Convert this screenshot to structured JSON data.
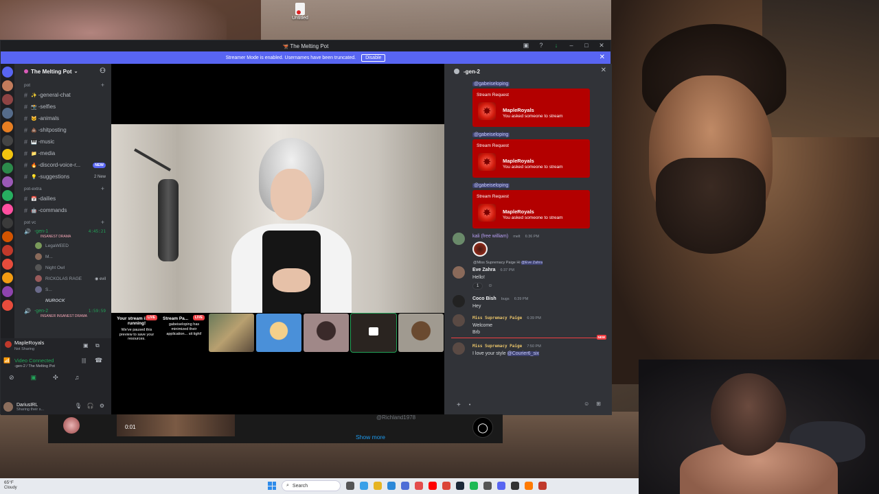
{
  "desktop": {
    "icon_label": "Untitled"
  },
  "window": {
    "title": "The Melting Pot"
  },
  "notice": {
    "text": "Streamer Mode is enabled. Usernames have been truncated.",
    "button": "Disable"
  },
  "guild": {
    "name": "The Melting Pot"
  },
  "categories": {
    "pot": "pot",
    "pot_extra": "pot-extra",
    "pot_vc": "pot vc"
  },
  "channels": [
    {
      "emoji": "✨",
      "name": "-general-chat"
    },
    {
      "emoji": "📸",
      "name": "-selfies"
    },
    {
      "emoji": "🐱",
      "name": "-animals"
    },
    {
      "emoji": "💩",
      "name": "-shitposting"
    },
    {
      "emoji": "🎹",
      "name": "-music"
    },
    {
      "emoji": "📁",
      "name": "-media"
    },
    {
      "emoji": "🔥",
      "name": "-discord-voice-r...",
      "badge": "NEW"
    },
    {
      "emoji": "💡",
      "name": "-suggestions",
      "count": "2 New"
    }
  ],
  "extra_channels": [
    {
      "emoji": "📅",
      "name": "-dailies"
    },
    {
      "emoji": "🤖",
      "name": "-commands"
    }
  ],
  "voice": {
    "gen1": {
      "name": "-gen-1",
      "time": "4:45:21",
      "status": "INSANEST DRAMA"
    },
    "gen1_users": [
      "LegaWEED",
      "M...",
      "Night Owl",
      "RICKOLAS RAGE",
      "S...",
      "NUROCK"
    ],
    "gen1_tags": {
      "rickolas": "evil"
    },
    "gen2": {
      "name": "-gen-2",
      "time": "1:59:59",
      "status": "INSANER INSANEST DRAMA"
    }
  },
  "panel": {
    "live_name": "MapleRoyals",
    "live_sub": "Not Sharing",
    "vc_status": "Video Connected",
    "vc_sub": "-gen-2 / The Melting Pot",
    "user_name": "DariusIRL",
    "user_status": "Sharing their s..."
  },
  "thumbs": [
    {
      "title": "Your stream is still running!",
      "text": "We've paused this preview to save your resources.",
      "live": "LIVE"
    },
    {
      "title": "Stream Pa...",
      "text": "gabeiseloping has minimized their application... sit tight!",
      "live": "LIVE"
    }
  ],
  "chat": {
    "channel": "-gen-2",
    "requests": [
      {
        "mention": "@gabeiseloping",
        "label": "Stream Request",
        "name": "MapleRoyals",
        "sub": "You asked someone to stream"
      },
      {
        "mention": "@gabeiseloping",
        "label": "Stream Request",
        "name": "MapleRoyals",
        "sub": "You asked someone to stream"
      },
      {
        "mention": "@gabeiseloping",
        "label": "Stream Request",
        "name": "MapleRoyals",
        "sub": "You asked someone to stream"
      }
    ],
    "messages": [
      {
        "name": "kali (free william)",
        "tag": "melt",
        "time": "6:36 PM",
        "text": ""
      },
      {
        "reply_name": "@Miss Supremacy Paige",
        "reply_text": "Hi",
        "reply_mention": "@Eve Zahra",
        "name": "Eve Zahra",
        "time": "6:37 PM",
        "text": "Hello!",
        "reaction": "1"
      },
      {
        "name": "Coco Bish",
        "tag": "bugs",
        "time": "6:39 PM",
        "text": "Hey"
      },
      {
        "name": "Miss Supremacy Paige",
        "time": "6:39 PM",
        "text": "Welcome",
        "text2": "Brb"
      },
      {
        "name": "Miss Supremacy Paige",
        "time": "7:50 PM",
        "text": "I love your style",
        "mention": "@Courier6_six"
      }
    ],
    "new_label": "NEW"
  },
  "browser": {
    "time": "0:01",
    "handle": "@Richland1978",
    "show_more": "Show more"
  },
  "taskbar": {
    "temp": "65°F",
    "weather": "Cloudy",
    "search": "Search"
  }
}
